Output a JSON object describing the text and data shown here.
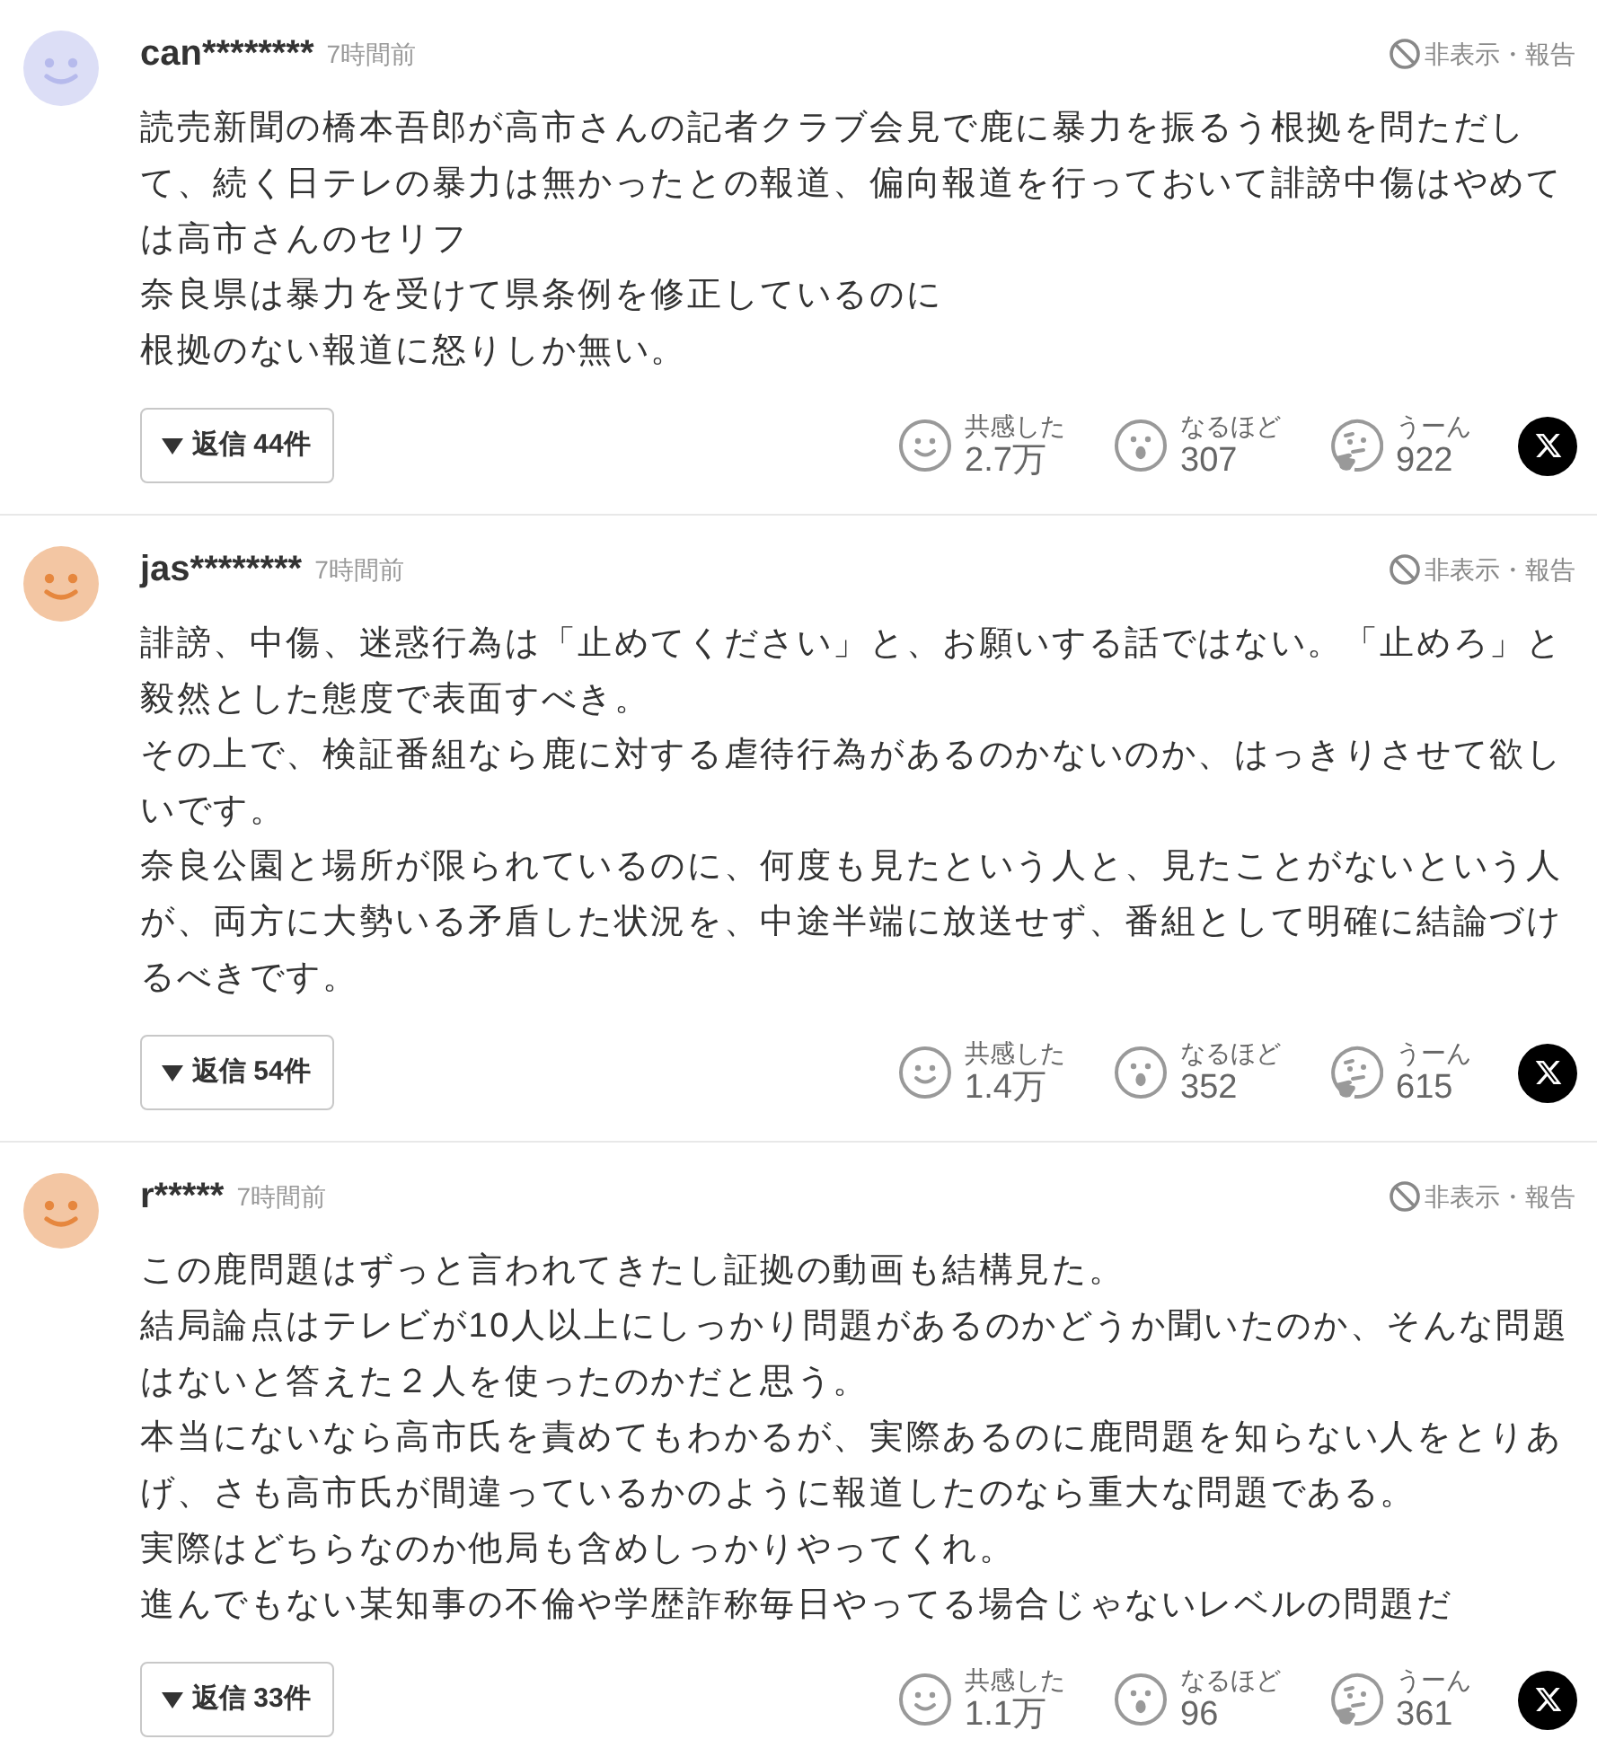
{
  "comments": [
    {
      "avatar": {
        "color": "#dcdef6"
      },
      "username": "can********",
      "time": "7時間前",
      "hide_report": "非表示・報告",
      "paragraphs": [
        "読売新聞の橋本吾郎が高市さんの記者クラブ会見で鹿に暴力を振るう根拠を問ただして、続く日テレの暴力は無かったとの報道、偏向報道を行っておいて誹謗中傷はやめては高市さんのセリフ",
        "奈良県は暴力を受けて県条例を修正しているのに",
        "根拠のない報道に怒りしか無い。"
      ],
      "replies_button": "返信 44件",
      "reactions": [
        {
          "kind": "empathy",
          "label": "共感した",
          "count": "2.7万"
        },
        {
          "kind": "insight",
          "label": "なるほど",
          "count": "307"
        },
        {
          "kind": "puzzled",
          "label": "うーん",
          "count": "922"
        }
      ]
    },
    {
      "avatar": {
        "color": "#f3c6a3"
      },
      "username": "jas********",
      "time": "7時間前",
      "hide_report": "非表示・報告",
      "paragraphs": [
        "誹謗、中傷、迷惑行為は「止めてください」と、お願いする話ではない。「止めろ」と毅然とした態度で表面すべき。",
        "その上で、検証番組なら鹿に対する虐待行為があるのかないのか、はっきりさせて欲しいです。",
        "奈良公園と場所が限られているのに、何度も見たという人と、見たことがないという人が、両方に大勢いる矛盾した状況を、中途半端に放送せず、番組として明確に結論づけるべきです。"
      ],
      "replies_button": "返信 54件",
      "reactions": [
        {
          "kind": "empathy",
          "label": "共感した",
          "count": "1.4万"
        },
        {
          "kind": "insight",
          "label": "なるほど",
          "count": "352"
        },
        {
          "kind": "puzzled",
          "label": "うーん",
          "count": "615"
        }
      ]
    },
    {
      "avatar": {
        "color": "#f3c6a3"
      },
      "username": "r*****",
      "time": "7時間前",
      "hide_report": "非表示・報告",
      "paragraphs": [
        "この鹿問題はずっと言われてきたし証拠の動画も結構見た。",
        "結局論点はテレビが10人以上にしっかり問題があるのかどうか聞いたのか、そんな問題はないと答えた２人を使ったのかだと思う。",
        "本当にないなら高市氏を責めてもわかるが、実際あるのに鹿問題を知らない人をとりあげ、さも高市氏が間違っているかのように報道したのなら重大な問題である。",
        "実際はどちらなのか他局も含めしっかりやってくれ。",
        "進んでもない某知事の不倫や学歴詐称毎日やってる場合じゃないレベルの問題だ"
      ],
      "replies_button": "返信 33件",
      "reactions": [
        {
          "kind": "empathy",
          "label": "共感した",
          "count": "1.1万"
        },
        {
          "kind": "insight",
          "label": "なるほど",
          "count": "96"
        },
        {
          "kind": "puzzled",
          "label": "うーん",
          "count": "361"
        }
      ]
    }
  ]
}
